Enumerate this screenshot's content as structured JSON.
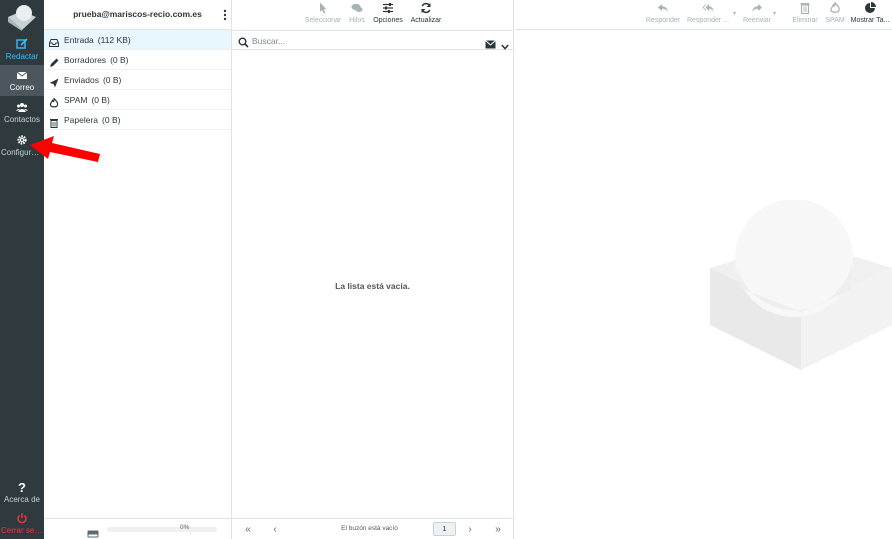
{
  "nav": {
    "compose": "Redactar",
    "mail": "Correo",
    "contacts": "Contactos",
    "settings": "Configuraci...",
    "about": "Acerca de",
    "logout": "Cerrar sesión"
  },
  "account": {
    "email": "prueba@mariscos-recio.com.es"
  },
  "folders": [
    {
      "name": "Entrada",
      "size": "(112 KB)"
    },
    {
      "name": "Borradores",
      "size": "(0 B)"
    },
    {
      "name": "Enviados",
      "size": "(0 B)"
    },
    {
      "name": "SPAM",
      "size": "(0 B)"
    },
    {
      "name": "Papelera",
      "size": "(0 B)"
    }
  ],
  "quota": {
    "percent": "0%",
    "fill": 0
  },
  "list_toolbar": {
    "select": "Seleccionar",
    "threads": "Hilos",
    "options": "Opciones",
    "refresh": "Actualizar"
  },
  "search": {
    "placeholder": "Buscar..."
  },
  "list": {
    "empty_message": "La lista está vacía."
  },
  "pager": {
    "status": "El buzón está vacío",
    "page": "1"
  },
  "message_toolbar": {
    "reply": "Responder",
    "reply_all": "Responder ...",
    "forward": "Reenviar",
    "delete": "Eliminar",
    "spam": "SPAM",
    "more": "Mostrar Ta..."
  },
  "colors": {
    "nav_bg": "#2f3a3f",
    "accent": "#37beff",
    "logout": "#f3333a",
    "selected_folder": "#e8f6fe",
    "annotation_arrow": "#ff0000"
  }
}
